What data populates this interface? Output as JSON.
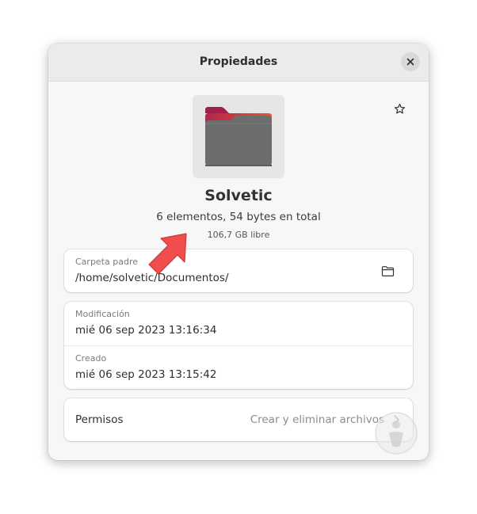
{
  "dialog": {
    "title": "Propiedades"
  },
  "icons": {
    "close": "close-icon",
    "star": "star-icon",
    "folder": "folder-icon",
    "open_folder": "folder-open-icon",
    "chevron": "chevron-right-icon",
    "annotation_arrow": "arrow-icon"
  },
  "folder": {
    "name": "Solvetic",
    "summary": "6 elementos, 54 bytes en total",
    "free_space": "106,7 GB libre"
  },
  "parent": {
    "label": "Carpeta padre",
    "value": "/home/solvetic/Documentos/"
  },
  "modified": {
    "label": "Modificación",
    "value": "mié 06 sep 2023 13:16:34"
  },
  "created": {
    "label": "Creado",
    "value": "mié 06 sep 2023 13:15:42"
  },
  "permissions": {
    "label": "Permisos",
    "value": "Crear y eliminar archivos"
  },
  "colors": {
    "folder_body": "#6d6d6d",
    "folder_tab_left": "#b0254f",
    "folder_tab_right": "#e9542b",
    "annotation_arrow": "#f04e4e"
  }
}
